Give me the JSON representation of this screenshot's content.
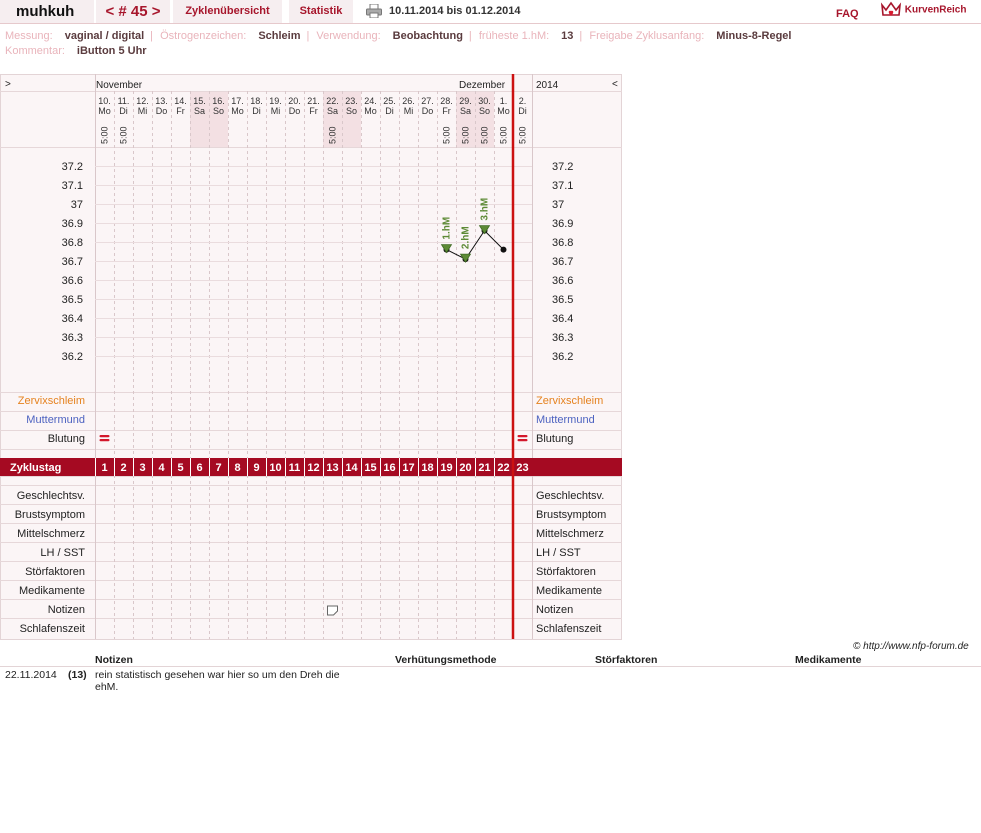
{
  "topbar": {
    "user": "muhkuh",
    "cycle": "< # 45 >",
    "tab_overview": "Zyklenübersicht",
    "tab_stats": "Statistik",
    "print_icon": "printer-icon",
    "date_range": "10.11.2014 bis 01.12.2014",
    "faq": "FAQ",
    "logo_text": "KurvenReich",
    "logo_icon": "crown-heart-icon"
  },
  "info": {
    "messung_label": "Messung:",
    "messung_value": "vaginal / digital",
    "oestrogen_label": "Östrogenzeichen:",
    "oestrogen_value": "Schleim",
    "verwendung_label": "Verwendung:",
    "verwendung_value": "Beobachtung",
    "frueheste_label": "früheste 1.hM:",
    "frueheste_value": "13",
    "freigabe_label": "Freigabe Zyklusanfang:",
    "freigabe_value": "Minus-8-Regel",
    "kommentar_label": "Kommentar:",
    "kommentar_value": "iButton 5 Uhr"
  },
  "chart_data": {
    "type": "line",
    "nav_left": ">",
    "nav_right": "<",
    "month1": "November",
    "month2": "Dezember",
    "year": "2014",
    "dates": [
      "10.",
      "11.",
      "12.",
      "13.",
      "14.",
      "15.",
      "16.",
      "17.",
      "18.",
      "19.",
      "20.",
      "21.",
      "22.",
      "23.",
      "24.",
      "25.",
      "26.",
      "27.",
      "28.",
      "29.",
      "30.",
      "1.",
      "2."
    ],
    "weekdays": [
      "Mo",
      "Di",
      "Mi",
      "Do",
      "Fr",
      "Sa",
      "So",
      "Mo",
      "Di",
      "Mi",
      "Do",
      "Fr",
      "Sa",
      "So",
      "Mo",
      "Di",
      "Mi",
      "Do",
      "Fr",
      "Sa",
      "So",
      "Mo",
      "Di"
    ],
    "times": [
      "5:00",
      "5:00",
      "",
      "",
      "",
      "",
      "",
      "",
      "",
      "",
      "",
      "",
      "5:00",
      "",
      "",
      "",
      "",
      "",
      "5:00",
      "5:00",
      "5:00",
      "5:00",
      "5:00"
    ],
    "shaded": [
      false,
      false,
      false,
      false,
      false,
      true,
      true,
      false,
      false,
      false,
      false,
      false,
      true,
      true,
      false,
      false,
      false,
      false,
      false,
      true,
      true,
      false,
      false
    ],
    "y_ticks": [
      "37.2",
      "37.1",
      "37",
      "36.9",
      "36.8",
      "36.7",
      "36.6",
      "36.5",
      "36.4",
      "36.3",
      "36.2"
    ],
    "ylim": [
      36.1,
      37.3
    ],
    "temps": [
      null,
      null,
      null,
      null,
      null,
      null,
      null,
      null,
      null,
      null,
      null,
      null,
      null,
      null,
      null,
      null,
      null,
      null,
      36.76,
      36.71,
      36.86,
      36.76,
      null
    ],
    "markers": [
      {
        "day": 19,
        "label": "1.hM"
      },
      {
        "day": 20,
        "label": "2.hM"
      },
      {
        "day": 21,
        "label": "3.hM"
      }
    ],
    "cycle_days": [
      "1",
      "2",
      "3",
      "4",
      "5",
      "6",
      "7",
      "8",
      "9",
      "10",
      "11",
      "12",
      "13",
      "14",
      "15",
      "16",
      "17",
      "18",
      "19",
      "20",
      "21",
      "22",
      "23"
    ],
    "cycle_label": "Zyklustag",
    "rows_top": [
      "Zervixschleim",
      "Muttermund",
      "Blutung"
    ],
    "rows_bottom": [
      "Geschlechtsv.",
      "Brustsymptom",
      "Mittelschmerz",
      "LH / SST",
      "Störfaktoren",
      "Medikamente",
      "Notizen",
      "Schlafenszeit"
    ],
    "bleeding_days": [
      1,
      23
    ],
    "note_day": 13,
    "colors": {
      "accent": "#a50a22",
      "zervix": "#e5821f",
      "muttermund": "#4c62c0",
      "temp_marker": "#5d8a35"
    }
  },
  "copyright": "© http://www.nfp-forum.de",
  "notes": {
    "headers": [
      "Notizen",
      "Verhütungsmethode",
      "Störfaktoren",
      "Medikamente"
    ],
    "rows": [
      {
        "date": "22.11.2014",
        "day": "(13)",
        "text": "rein statistisch gesehen war hier so um den Dreh die ehM."
      }
    ]
  }
}
